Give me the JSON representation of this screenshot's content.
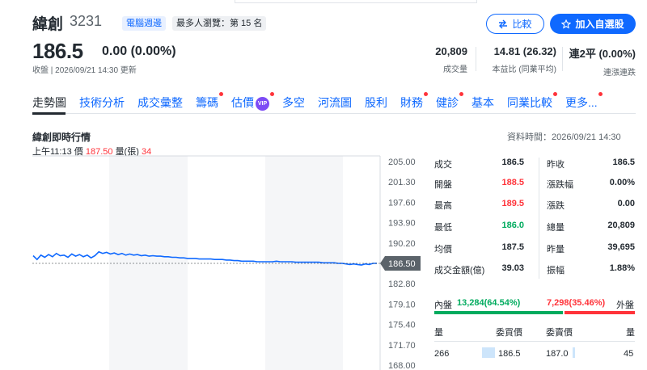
{
  "stock": {
    "name": "緯創",
    "code": "3231",
    "tag": "電腦週邊",
    "rank": "最多人瀏覽：第 15 名",
    "price": "186.5",
    "change": "0.00 (0.00%)",
    "time": "收盤 | 2026/09/21 14:30 更新"
  },
  "actions": {
    "compare": "比較",
    "watchlist": "加入自選股"
  },
  "stats": [
    {
      "value": "20,809",
      "label": "成交量"
    },
    {
      "value": "14.81 (26.32)",
      "label": "本益比 (同業平均)"
    },
    {
      "value": "連2平 (0.00%)",
      "label": "連漲連跌"
    }
  ],
  "tabs": [
    {
      "label": "走勢圖",
      "dot": false
    },
    {
      "label": "技術分析",
      "dot": false
    },
    {
      "label": "成交彙整",
      "dot": false
    },
    {
      "label": "籌碼",
      "dot": true
    },
    {
      "label": "估價",
      "dot": true,
      "vip": "VIP"
    },
    {
      "label": "多空",
      "dot": false
    },
    {
      "label": "河流圖",
      "dot": false
    },
    {
      "label": "股利",
      "dot": false
    },
    {
      "label": "財務",
      "dot": true
    },
    {
      "label": "健診",
      "dot": true
    },
    {
      "label": "基本",
      "dot": false
    },
    {
      "label": "同業比較",
      "dot": true
    },
    {
      "label": "更多...",
      "dot": true
    }
  ],
  "section": {
    "title": "緯創即時行情",
    "data_time": "資料時間：2026/09/21 14:30",
    "info_time": "上午11:13",
    "info_price_label": "價",
    "info_price": "187.50",
    "info_vol_label": "量(張)",
    "info_vol": "34"
  },
  "chart_data": {
    "type": "line",
    "y_ticks": [
      "205.00",
      "201.30",
      "197.60",
      "193.90",
      "190.20",
      "186.50",
      "182.80",
      "179.10",
      "175.40",
      "171.70",
      "168.00"
    ],
    "ylim": [
      168.0,
      205.0
    ],
    "current": "186.50",
    "values": [
      187.9,
      187.2,
      188.0,
      187.6,
      188.1,
      187.7,
      188.3,
      187.9,
      188.0,
      187.6,
      188.2,
      187.8,
      188.1,
      187.7,
      188.0,
      187.5,
      187.9,
      188.6,
      188.3,
      188.5,
      188.2,
      188.4,
      188.1,
      188.3,
      188.0,
      188.2,
      188.0,
      188.1,
      187.9,
      188.0,
      187.8,
      187.9,
      187.8,
      187.8,
      187.7,
      187.7,
      187.6,
      187.6,
      187.5,
      187.5,
      187.4,
      187.4,
      187.4,
      187.3,
      187.3,
      187.3,
      187.3,
      187.2,
      187.2,
      187.2,
      187.1,
      187.1,
      187.0,
      187.0,
      186.9,
      186.9,
      186.9,
      186.9,
      186.8,
      186.8,
      186.8,
      186.8,
      186.8,
      186.9,
      186.8,
      186.8,
      186.8,
      186.8,
      186.7,
      186.7,
      186.7,
      186.7,
      186.7,
      186.7,
      186.7,
      186.6,
      186.6,
      186.6,
      186.6,
      186.5,
      186.5,
      186.4,
      186.3,
      186.4,
      186.3,
      186.2,
      186.4,
      186.3,
      186.5,
      186.5
    ]
  },
  "quote": {
    "left": [
      {
        "label": "成交",
        "value": "186.5",
        "color": ""
      },
      {
        "label": "開盤",
        "value": "188.5",
        "color": "red"
      },
      {
        "label": "最高",
        "value": "189.5",
        "color": "red"
      },
      {
        "label": "最低",
        "value": "186.0",
        "color": "green"
      },
      {
        "label": "均價",
        "value": "187.5",
        "color": ""
      },
      {
        "label": "成交金額(億)",
        "value": "39.03",
        "color": ""
      }
    ],
    "right": [
      {
        "label": "昨收",
        "value": "186.5"
      },
      {
        "label": "漲跌幅",
        "value": "0.00%"
      },
      {
        "label": "漲跌",
        "value": "0.00"
      },
      {
        "label": "總量",
        "value": "20,809"
      },
      {
        "label": "昨量",
        "value": "39,695"
      },
      {
        "label": "振幅",
        "value": "1.88%"
      }
    ]
  },
  "inout": {
    "in_label": "內盤",
    "in_value": "13,284(64.54%)",
    "out_value": "7,298(35.46%)",
    "out_label": "外盤",
    "in_pct": 64.54
  },
  "orderbook": {
    "headers": [
      "量",
      "委買價",
      "委賣價",
      "量"
    ],
    "rows": [
      {
        "bid_vol": "266",
        "bid": "186.5",
        "ask": "187.0",
        "ask_vol": "45"
      }
    ]
  },
  "colors": {
    "accent": "#0f69ff",
    "up": "#ff333a",
    "down": "#00ab5e",
    "line": "#0f69ff"
  }
}
